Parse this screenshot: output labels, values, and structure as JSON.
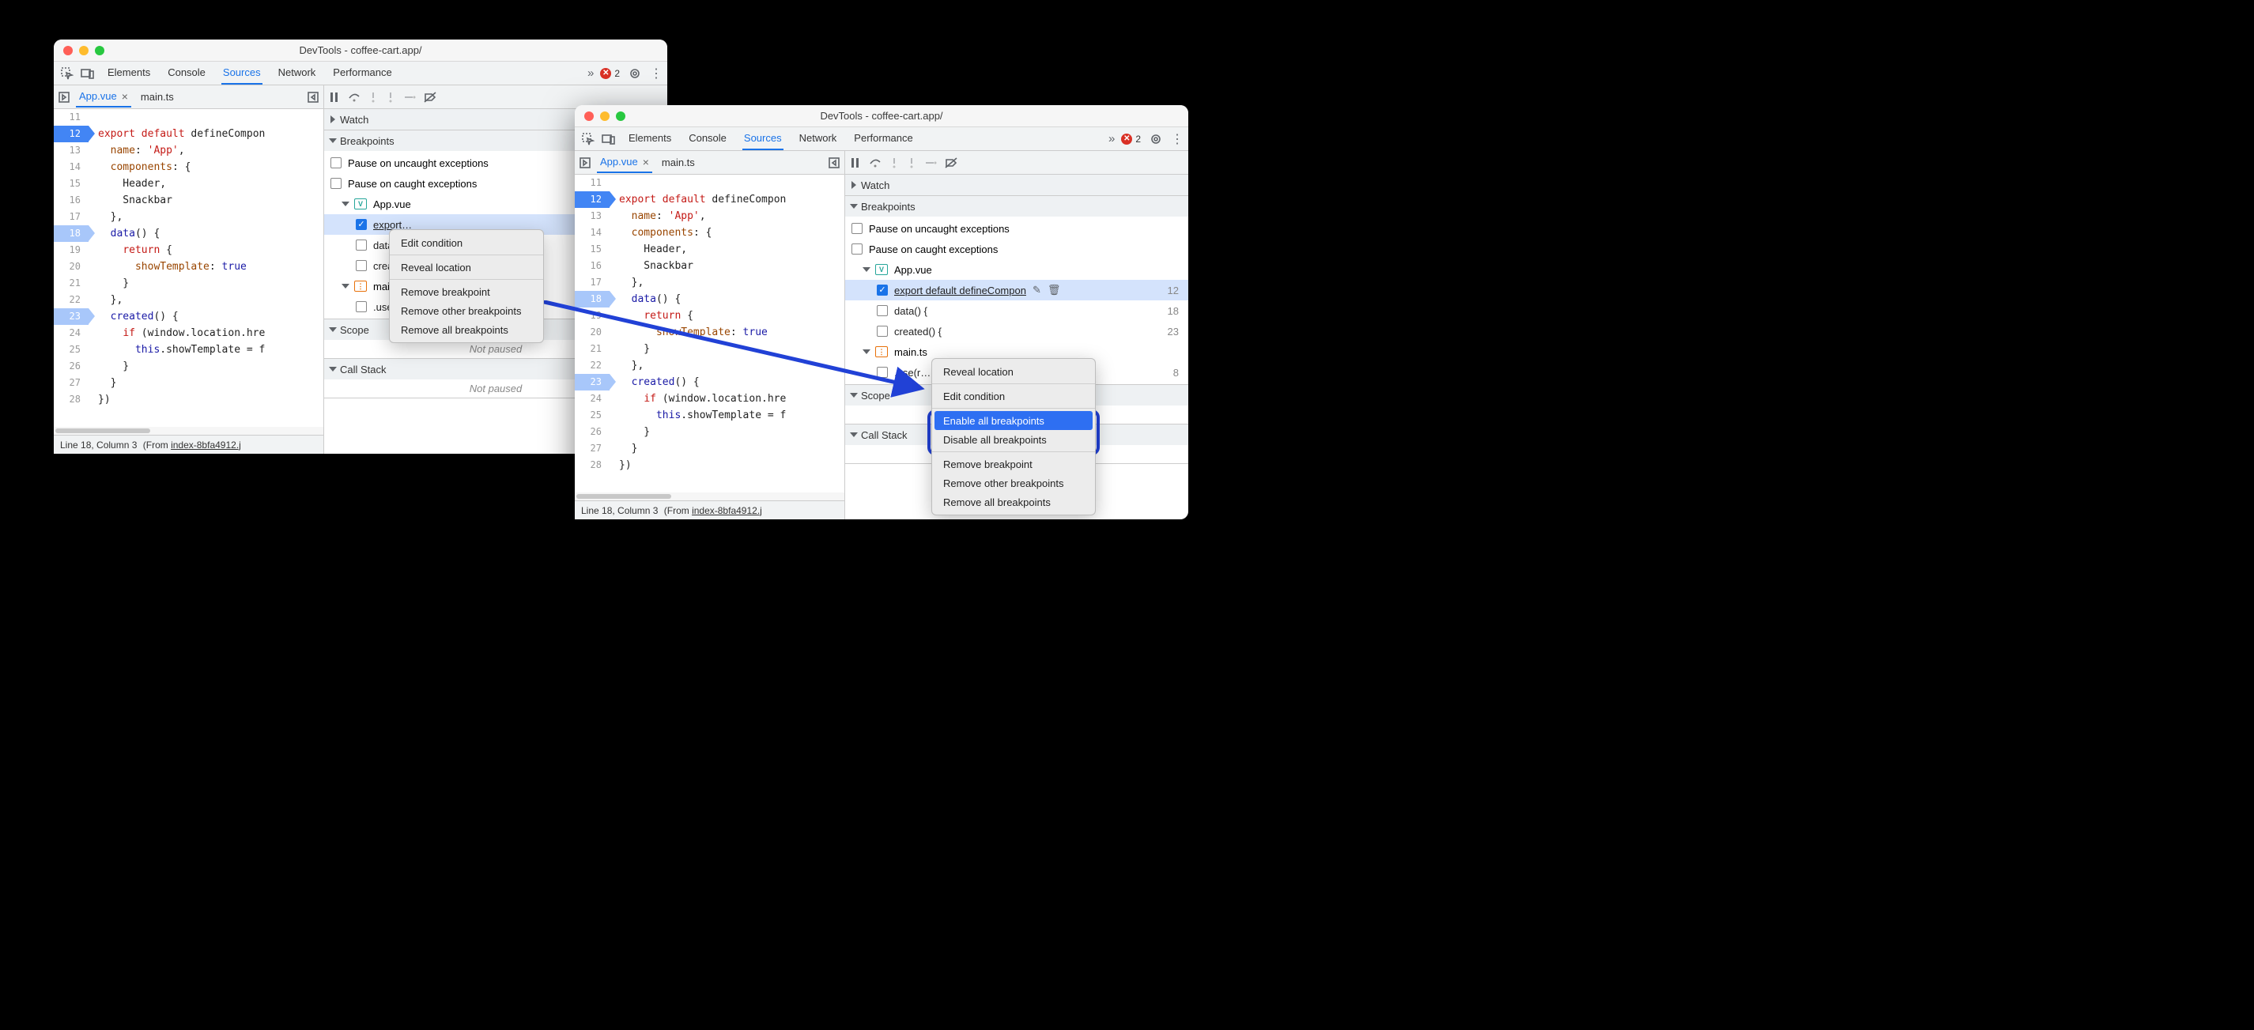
{
  "title": "DevTools - coffee-cart.app/",
  "tabs": {
    "elements": "Elements",
    "console": "Console",
    "sources": "Sources",
    "network": "Network",
    "performance": "Performance"
  },
  "errorCount": "2",
  "fileTabs": {
    "active": "App.vue",
    "other": "main.ts"
  },
  "code": [
    {
      "n": "11",
      "t": "",
      "bp": ""
    },
    {
      "n": "12",
      "t": "export default defineCompon",
      "bp": "bp",
      "tokens": [
        [
          "k-red",
          "export "
        ],
        [
          "k-red",
          "default "
        ],
        [
          "",
          "defineCompon"
        ]
      ]
    },
    {
      "n": "13",
      "t": "  name: 'App',",
      "tokens": [
        [
          "",
          "  "
        ],
        [
          "k-prop",
          "name"
        ],
        [
          "",
          ": "
        ],
        [
          "k-str",
          "'App'"
        ],
        [
          "",
          ","
        ]
      ]
    },
    {
      "n": "14",
      "t": "  components: {",
      "tokens": [
        [
          "",
          "  "
        ],
        [
          "k-prop",
          "components"
        ],
        [
          "",
          ": {"
        ]
      ]
    },
    {
      "n": "15",
      "t": "    Header,",
      "tokens": [
        [
          "",
          "    Header,"
        ]
      ]
    },
    {
      "n": "16",
      "t": "    Snackbar",
      "tokens": [
        [
          "",
          "    Snackbar"
        ]
      ]
    },
    {
      "n": "17",
      "t": "  },",
      "tokens": [
        [
          "",
          "  },"
        ]
      ]
    },
    {
      "n": "18",
      "t": "  data() {",
      "bp": "bp light",
      "tokens": [
        [
          "",
          "  "
        ],
        [
          "k-blue",
          "data"
        ],
        [
          "",
          "() {"
        ]
      ]
    },
    {
      "n": "19",
      "t": "    return {",
      "tokens": [
        [
          "",
          "    "
        ],
        [
          "k-red",
          "return"
        ],
        [
          "",
          " {"
        ]
      ]
    },
    {
      "n": "20",
      "t": "      showTemplate: true",
      "tokens": [
        [
          "",
          "      "
        ],
        [
          "k-prop",
          "showTemplate"
        ],
        [
          "",
          ": "
        ],
        [
          "k-val",
          "true"
        ]
      ]
    },
    {
      "n": "21",
      "t": "    }",
      "tokens": [
        [
          "",
          "    }"
        ]
      ]
    },
    {
      "n": "22",
      "t": "  },",
      "tokens": [
        [
          "",
          "  },"
        ]
      ]
    },
    {
      "n": "23",
      "t": "  created() {",
      "bp": "bp light",
      "tokens": [
        [
          "",
          "  "
        ],
        [
          "k-blue",
          "created"
        ],
        [
          "",
          "() {"
        ]
      ]
    },
    {
      "n": "24",
      "t": "    if (window.location.hre",
      "tokens": [
        [
          "",
          "    "
        ],
        [
          "k-red",
          "if"
        ],
        [
          "",
          " (window.location.hre"
        ]
      ]
    },
    {
      "n": "25",
      "t": "      this.showTemplate = f",
      "tokens": [
        [
          "",
          "      "
        ],
        [
          "k-val",
          "this"
        ],
        [
          "",
          ".showTemplate = f"
        ]
      ]
    },
    {
      "n": "26",
      "t": "    }",
      "tokens": [
        [
          "",
          "    }"
        ]
      ]
    },
    {
      "n": "27",
      "t": "  }",
      "tokens": [
        [
          "",
          "  }"
        ]
      ]
    },
    {
      "n": "28",
      "t": "})",
      "tokens": [
        [
          "",
          "})"
        ]
      ]
    }
  ],
  "sections": {
    "watch": "Watch",
    "breakpoints": "Breakpoints",
    "scope": "Scope",
    "callstack": "Call Stack"
  },
  "bpPane": {
    "uncaught": "Pause on uncaught exceptions",
    "caught": "Pause on caught exceptions",
    "file1": "App.vue",
    "file2": "main.ts",
    "bp1": "export default defineCompon",
    "bp2": "data() {",
    "bp3": "created() {",
    "bp4": ".use(router)",
    "ln_bp1": "12",
    "ln_bp2": "18",
    "ln_bp3": "23",
    "ln_bp4": "8"
  },
  "notPaused": "Not paused",
  "status": {
    "pos": "Line 18, Column 3",
    "from1": "(From ",
    "fromLink": "index-8bfa4912.j",
    "from2": ""
  },
  "ctxA": {
    "edit": "Edit condition",
    "reveal": "Reveal location",
    "remove": "Remove breakpoint",
    "removeOther": "Remove other breakpoints",
    "removeAll": "Remove all breakpoints"
  },
  "ctxB": {
    "reveal": "Reveal location",
    "edit": "Edit condition",
    "enableAll": "Enable all breakpoints",
    "disableAll": "Disable all breakpoints",
    "remove": "Remove breakpoint",
    "removeOther": "Remove other breakpoints",
    "removeAll": "Remove all breakpoints"
  }
}
